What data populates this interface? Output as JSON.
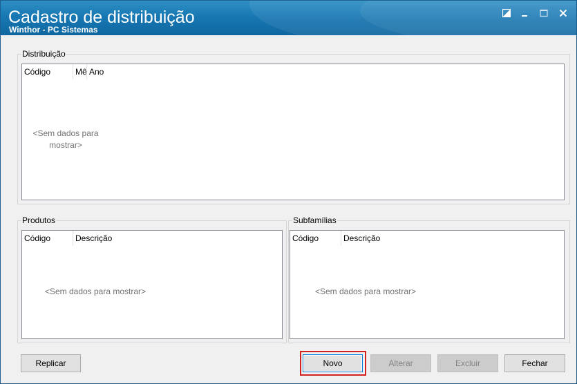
{
  "window": {
    "title": "Cadastro de distribuição",
    "subtitle": "Winthor - PC Sistemas"
  },
  "distribuicao": {
    "label": "Distribuição",
    "columns": [
      "Código",
      "Mês",
      "Ano"
    ],
    "empty_text": "<Sem dados para mostrar>"
  },
  "produtos": {
    "label": "Produtos",
    "columns": [
      "Código",
      "Descrição"
    ],
    "empty_text": "<Sem dados para mostrar>"
  },
  "subfamilias": {
    "label": "Subfamílias",
    "columns": [
      "Código",
      "Descrição"
    ],
    "empty_text": "<Sem dados para mostrar>"
  },
  "buttons": {
    "replicar": "Replicar",
    "novo": "Novo",
    "alterar": "Alterar",
    "excluir": "Excluir",
    "fechar": "Fechar"
  },
  "colors": {
    "titlebar": "#1878b3",
    "highlight": "#d21f1f"
  }
}
